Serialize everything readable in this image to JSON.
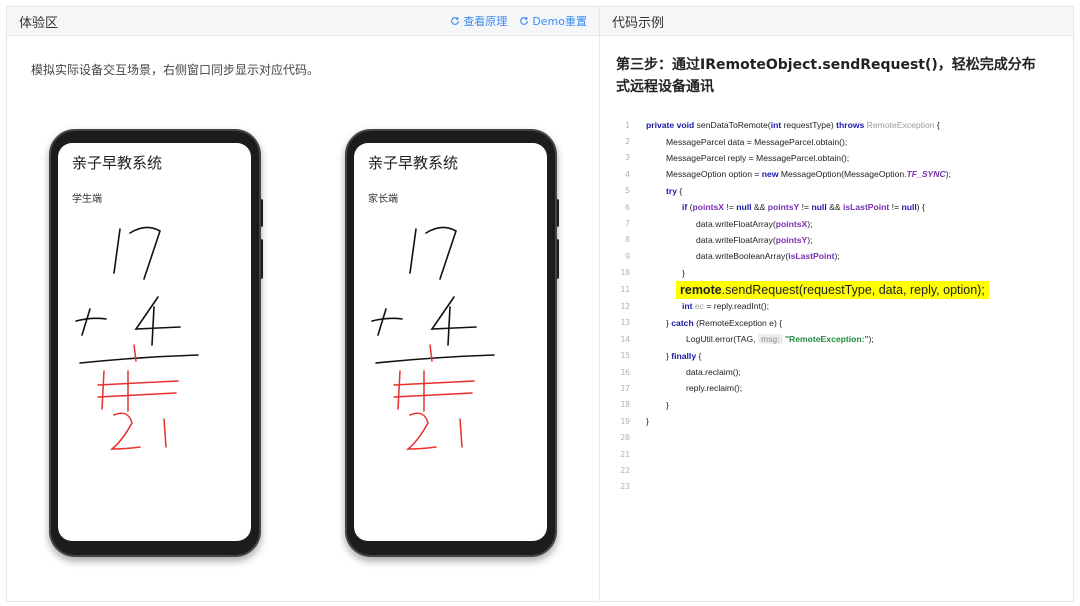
{
  "left_panel": {
    "title": "体验区",
    "actions": [
      {
        "label": "查看原理",
        "icon": "refresh-icon"
      },
      {
        "label": "Demo重置",
        "icon": "refresh-icon"
      }
    ],
    "description": "模拟实际设备交互场景，右侧窗口同步显示对应代码。",
    "phones": [
      {
        "app_title": "亲子早教系统",
        "role": "学生端"
      },
      {
        "app_title": "亲子早教系统",
        "role": "家长端"
      }
    ]
  },
  "right_panel": {
    "title": "代码示例",
    "step_title": "第三步：通过IRemoteObject.sendRequest()，轻松完成分布式远程设备通讯",
    "code": {
      "l1_kw": "private void",
      "l1_name": " senDataToRemote(",
      "l1_int": "int",
      "l1_param": " requestType) ",
      "l1_throws": "throws",
      "l1_exc": " RemoteException",
      "l1_end": " {",
      "l2": "MessageParcel data = MessageParcel.obtain();",
      "l3": "MessageParcel reply = MessageParcel.obtain();",
      "l4_a": "MessageOption option = ",
      "l4_new": "new",
      "l4_b": " MessageOption(MessageOption.",
      "l4_const": "TF_SYNC",
      "l4_c": ");",
      "l5": "try",
      "l5_end": " {",
      "l6_if": "if",
      "l6_a": " (",
      "l6_v1": "pointsX",
      "l6_b": " != ",
      "l6_null1": "null",
      "l6_c": " && ",
      "l6_v2": "pointsY",
      "l6_d": " != ",
      "l6_null2": "null",
      "l6_e": " && ",
      "l6_v3": "isLastPoint",
      "l6_f": " != ",
      "l6_null3": "null",
      "l6_g": ") {",
      "l7_a": "data.writeFloatArray(",
      "l7_v": "pointsX",
      "l7_b": ");",
      "l8_a": "data.writeFloatArray(",
      "l8_v": "pointsY",
      "l8_b": ");",
      "l9_a": "data.writeBooleanArray(",
      "l9_v": "isLastPoint",
      "l9_b": ");",
      "l10": "}",
      "l11_remote": "remote",
      "l11_rest": ".sendRequest(requestType, data, reply, option);",
      "l12_int": "int",
      "l12_ec": " ec",
      "l12_rest": " = reply.readInt();",
      "l13_a": "} ",
      "l13_catch": "catch",
      "l13_b": " (RemoteException e) {",
      "l14_a": "LogUtil.error(TAG, ",
      "l14_hint": "msg:",
      "l14_str": " \"RemoteException:\"",
      "l14_b": ");",
      "l15_a": "} ",
      "l15_finally": "finally",
      "l15_b": " {",
      "l16": "data.reclaim();",
      "l17": "reply.reclaim();",
      "l18": "}",
      "l19": "}"
    },
    "line_numbers": [
      "1",
      "2",
      "3",
      "4",
      "5",
      "6",
      "7",
      "8",
      "9",
      "10",
      "11",
      "12",
      "13",
      "14",
      "15",
      "16",
      "17",
      "18",
      "19",
      "20",
      "21",
      "22",
      "23"
    ]
  },
  "colors": {
    "accent": "#3a8bf0",
    "highlight": "#ffff00",
    "keyword": "#1a1aa6",
    "variable": "#7a2fb3",
    "string": "#1e8a3a",
    "drawing_black": "#111111",
    "drawing_red": "#e8302a"
  }
}
